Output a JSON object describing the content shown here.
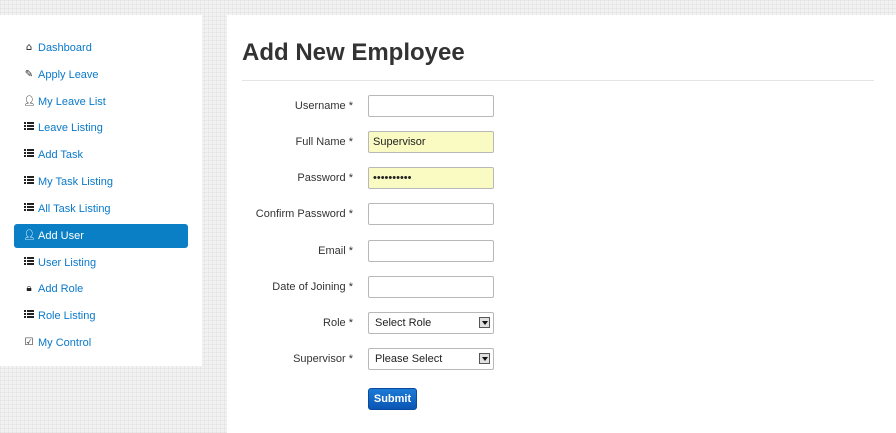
{
  "sidebar": {
    "items": [
      {
        "label": "Dashboard",
        "icon": "home-icon"
      },
      {
        "label": "Apply Leave",
        "icon": "pencil-icon"
      },
      {
        "label": "My Leave List",
        "icon": "user-icon"
      },
      {
        "label": "Leave Listing",
        "icon": "list-icon"
      },
      {
        "label": "Add Task",
        "icon": "list-icon"
      },
      {
        "label": "My Task Listing",
        "icon": "list-icon"
      },
      {
        "label": "All Task Listing",
        "icon": "list-icon"
      },
      {
        "label": "Add User",
        "icon": "user-icon",
        "active": true
      },
      {
        "label": "User Listing",
        "icon": "list-icon"
      },
      {
        "label": "Add Role",
        "icon": "lock-icon"
      },
      {
        "label": "Role Listing",
        "icon": "list-icon"
      },
      {
        "label": "My Control",
        "icon": "edit-icon"
      }
    ]
  },
  "main": {
    "title": "Add New Employee",
    "form": {
      "username": {
        "label": "Username *",
        "value": ""
      },
      "full_name": {
        "label": "Full Name *",
        "value": "Supervisor"
      },
      "password": {
        "label": "Password *",
        "value": "supervisor"
      },
      "confirm_password": {
        "label": "Confirm Password *",
        "value": ""
      },
      "email": {
        "label": "Email *",
        "value": ""
      },
      "date_of_joining": {
        "label": "Date of Joining *",
        "value": ""
      },
      "role": {
        "label": "Role *",
        "selected": "Select Role"
      },
      "supervisor": {
        "label": "Supervisor *",
        "selected": "Please Select"
      },
      "submit_label": "Submit"
    }
  },
  "colors": {
    "accent": "#0b7fc6",
    "link": "#0a79c9",
    "autofill": "#fafbc3",
    "button": "#0b55b5"
  }
}
